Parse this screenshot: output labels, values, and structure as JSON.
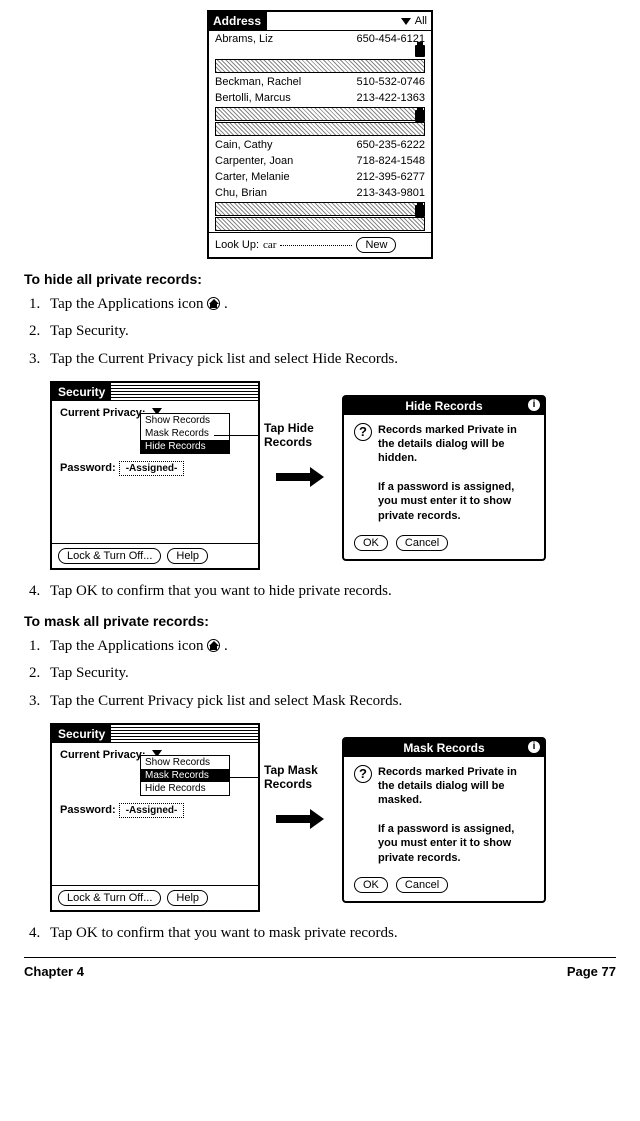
{
  "address": {
    "title": "Address",
    "category": "All",
    "rows": [
      {
        "type": "record",
        "name": "Abrams, Liz",
        "phone": "650-454-6121",
        "lock": true
      },
      {
        "type": "masked"
      },
      {
        "type": "record",
        "name": "Beckman, Rachel",
        "phone": "510-532-0746"
      },
      {
        "type": "record",
        "name": "Bertolli, Marcus",
        "phone": "213-422-1363"
      },
      {
        "type": "masked",
        "lock": true
      },
      {
        "type": "masked"
      },
      {
        "type": "record",
        "name": "Cain, Cathy",
        "phone": "650-235-6222"
      },
      {
        "type": "record",
        "name": "Carpenter, Joan",
        "phone": "718-824-1548"
      },
      {
        "type": "record",
        "name": "Carter, Melanie",
        "phone": "212-395-6277"
      },
      {
        "type": "record",
        "name": "Chu, Brian",
        "phone": "213-343-9801"
      },
      {
        "type": "masked",
        "lock": true
      },
      {
        "type": "masked"
      }
    ],
    "lookup_label": "Look Up:",
    "lookup_value": "car",
    "new_label": "New"
  },
  "hide": {
    "heading": "To hide all private records:",
    "steps": [
      "Tap the Applications icon",
      "Tap Security.",
      "Tap the Current Privacy pick list and select Hide Records."
    ],
    "step4": "Tap OK to confirm that you want to hide private records.",
    "annot": "Tap Hide Records",
    "security": {
      "title": "Security",
      "label_privacy": "Current Privacy:",
      "options": [
        "Show Records",
        "Mask Records",
        "Hide Records"
      ],
      "selected": "Hide Records",
      "label_password": "Password:",
      "assigned": "-Assigned-",
      "lock": "Lock & Turn Off...",
      "help": "Help"
    },
    "dialog": {
      "title": "Hide Records",
      "line1": "Records marked Private in the details dialog will be hidden.",
      "line2": "If a password is assigned, you must enter it to show private records.",
      "ok": "OK",
      "cancel": "Cancel"
    }
  },
  "mask": {
    "heading": "To mask all private records:",
    "steps": [
      "Tap the Applications icon",
      "Tap Security.",
      "Tap the Current Privacy pick list and select Mask Records."
    ],
    "step4": "Tap OK to confirm that you want to mask private records.",
    "annot": "Tap Mask Records",
    "security": {
      "title": "Security",
      "label_privacy": "Current Privacy:",
      "options": [
        "Show Records",
        "Mask Records",
        "Hide Records"
      ],
      "selected": "Mask Records",
      "label_password": "Password:",
      "assigned": "-Assigned-",
      "lock": "Lock & Turn Off...",
      "help": "Help"
    },
    "dialog": {
      "title": "Mask Records",
      "line1": "Records marked Private in the details dialog will be masked.",
      "line2": "If a password is assigned, you must enter it to show private records.",
      "ok": "OK",
      "cancel": "Cancel"
    }
  },
  "footer": {
    "left": "Chapter 4",
    "right": "Page 77"
  }
}
